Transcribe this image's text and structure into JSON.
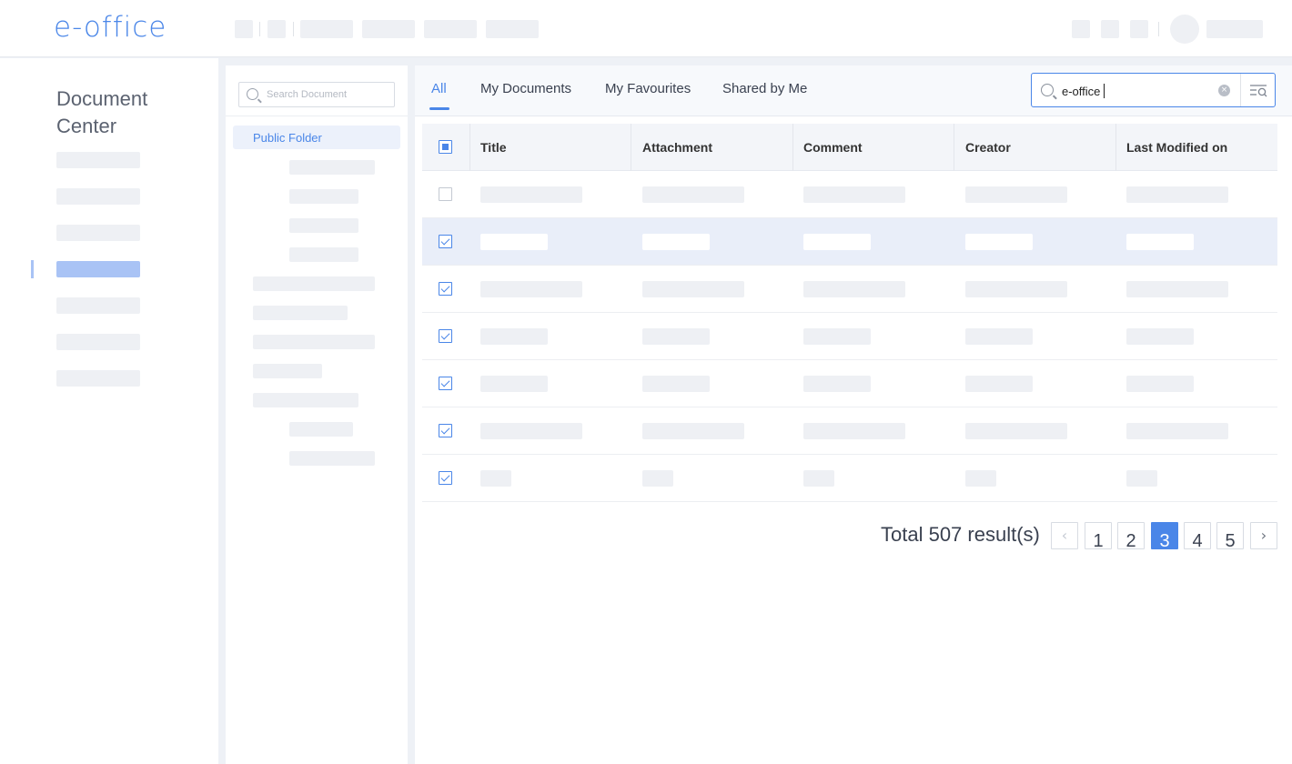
{
  "app": {
    "logo": "e-office"
  },
  "sidebar": {
    "title": "Document Center"
  },
  "folders": {
    "search_placeholder": "Search Document",
    "root_label": "Public Folder"
  },
  "tabs": [
    {
      "label": "All",
      "active": true
    },
    {
      "label": "My Documents"
    },
    {
      "label": "My Favourites"
    },
    {
      "label": "Shared by Me"
    }
  ],
  "search": {
    "query": "e-office"
  },
  "table": {
    "columns": [
      "Title",
      "Attachment",
      "Comment",
      "Creator",
      "Last Modified on"
    ],
    "rows": [
      {
        "checked": false,
        "selected": false
      },
      {
        "checked": true,
        "selected": true
      },
      {
        "checked": true,
        "selected": false
      },
      {
        "checked": true,
        "selected": false
      },
      {
        "checked": true,
        "selected": false
      },
      {
        "checked": true,
        "selected": false
      },
      {
        "checked": true,
        "selected": false
      }
    ]
  },
  "pagination": {
    "total_text": "Total 507 result(s)",
    "pages": [
      "1",
      "2",
      "3",
      "4",
      "5"
    ],
    "current": "3",
    "prev_icon": "chevron-left-icon",
    "next_icon": "chevron-right-icon"
  },
  "colors": {
    "accent": "#4a86e8",
    "selected_row": "#e9eef9",
    "placeholder": "#eef0f4"
  }
}
